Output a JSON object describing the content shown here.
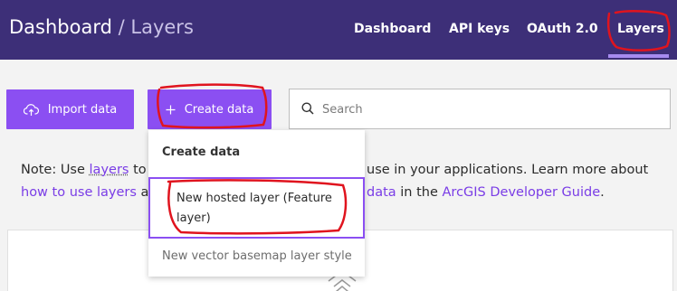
{
  "header": {
    "breadcrumb_root": "Dashboard",
    "breadcrumb_sep": "/",
    "breadcrumb_current": "Layers",
    "nav": [
      {
        "label": "Dashboard"
      },
      {
        "label": "API keys"
      },
      {
        "label": "OAuth 2.0"
      },
      {
        "label": "Layers",
        "active": true
      }
    ]
  },
  "toolbar": {
    "import_label": "Import data",
    "create_label": "Create data",
    "search_placeholder": "Search"
  },
  "dropdown": {
    "header": "Create data",
    "item_hosted_layer": "New hosted layer (Feature layer)",
    "item_vector_style": "New vector basemap layer style"
  },
  "note": {
    "line1_prefix": "Note: Use ",
    "line1_link": "layers",
    "line1_mid": " to",
    "line1_suffix": "use in your applications. Learn more about",
    "line2_link1": "how to use layers",
    "line2_mid": " a",
    "line2_link2": "data",
    "line2_text": " in the ",
    "line2_link3": "ArcGIS Developer Guide",
    "line2_end": "."
  },
  "colors": {
    "topbar": "#3d2f78",
    "accent": "#8b4ff2",
    "link": "#7a3de6",
    "annotation": "#e0141e"
  }
}
